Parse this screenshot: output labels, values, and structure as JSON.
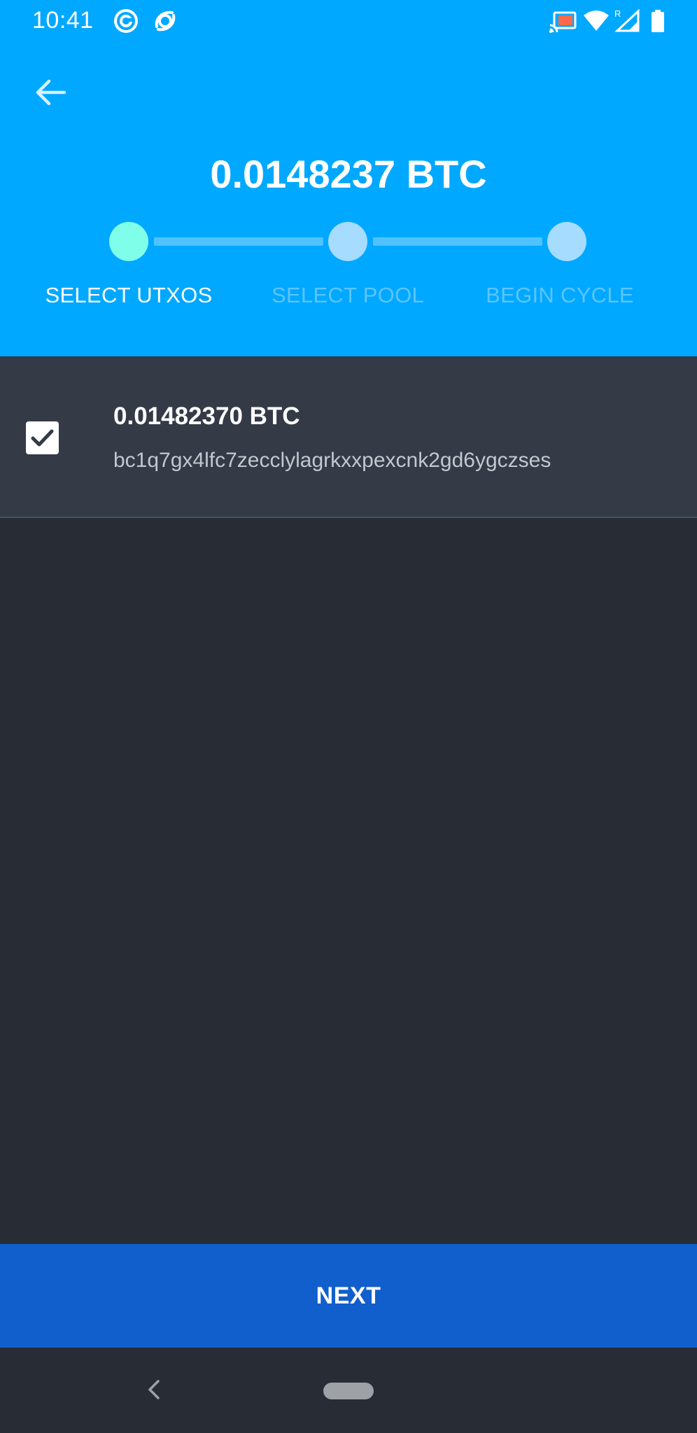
{
  "status_bar": {
    "time": "10:41",
    "left_icons": [
      "circle-app-icon",
      "swirl-app-icon"
    ],
    "right_icons": [
      "cast-icon",
      "wifi-icon",
      "signal-icon",
      "battery-icon"
    ],
    "roaming_indicator": "R"
  },
  "header": {
    "back_icon": "arrow-left-icon",
    "amount": "0.0148237 BTC",
    "steps": [
      {
        "label": "SELECT UTXOS",
        "state": "active"
      },
      {
        "label": "SELECT POOL",
        "state": "inactive"
      },
      {
        "label": "BEGIN CYCLE",
        "state": "inactive"
      }
    ]
  },
  "utxos": [
    {
      "checked": true,
      "amount": "0.01482370 BTC",
      "address": "bc1q7gx4lfc7zecclylagrkxxpexcnk2gd6ygczses"
    }
  ],
  "footer": {
    "next_label": "NEXT"
  },
  "nav": {
    "back_icon": "chevron-left-icon",
    "home_icon": "home-pill-icon"
  },
  "colors": {
    "header_bg": "#00a8ff",
    "step_active": "#7fffe9",
    "step_inactive": "#a6dcff",
    "label_inactive": "#5cc4ff",
    "row_bg": "#343a46",
    "body_bg": "#282c34",
    "button_bg": "#115fcc"
  }
}
